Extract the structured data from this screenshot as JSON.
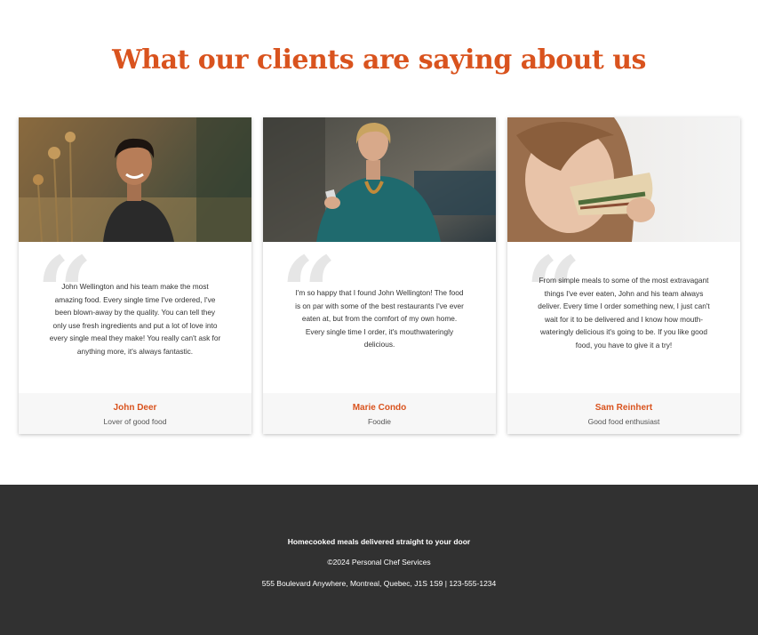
{
  "colors": {
    "accent": "#d9531e",
    "footer_bg": "#313131"
  },
  "section": {
    "title": "What our clients are saying about us"
  },
  "testimonials": [
    {
      "photo_icon": "portrait-man-photo",
      "quote": "John Wellington and his team make the most amazing food. Every single time I've ordered, I've been blown-away by the quality. You can tell they only use fresh ingredients and put a lot of love into every single meal they make! You really can't ask for anything more, it's always fantastic.",
      "name": "John Deer",
      "role": "Lover of good food"
    },
    {
      "photo_icon": "portrait-woman-phone-photo",
      "quote": "I'm so happy that I found John Wellington! The food is on par with some of the best restaurants I've ever eaten at, but from the comfort of my own home. Every single time I order, it's mouthwateringly delicious.",
      "name": "Marie Condo",
      "role": "Foodie"
    },
    {
      "photo_icon": "portrait-woman-sandwich-photo",
      "quote": "From simple meals to some of the most extravagant things I've ever eaten, John and his team always deliver. Every time I order something new, I just can't wait for it to be delivered and I know how mouth-wateringly delicious it's going to be. If you like good food, you have to give it a try!",
      "name": "Sam Reinhert",
      "role": "Good food enthusiast"
    }
  ],
  "footer": {
    "tagline": "Homecooked meals delivered straight to your door",
    "copyright": "©2024 Personal Chef Services",
    "address": "555 Boulevard Anywhere, Montreal, Quebec, J1S 1S9 | 123-555-1234"
  }
}
